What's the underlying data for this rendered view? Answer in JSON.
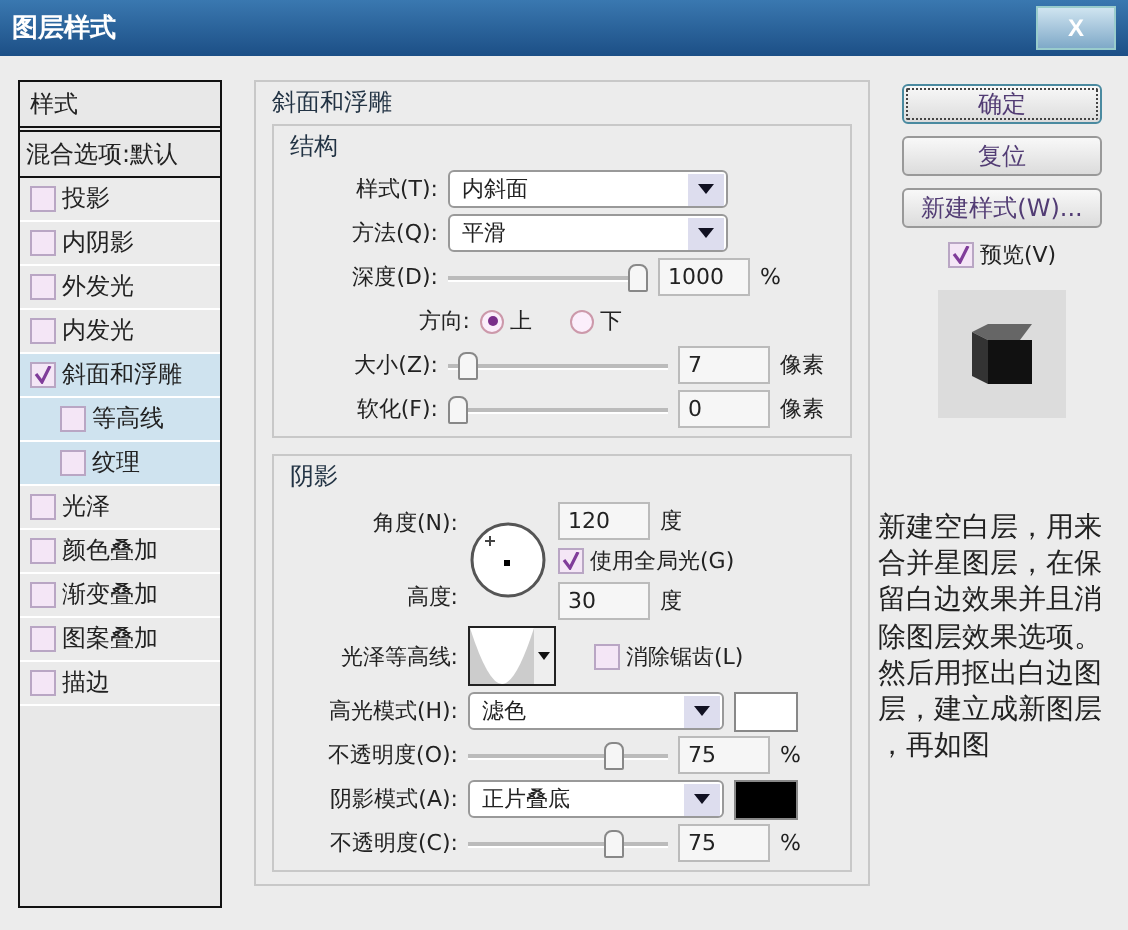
{
  "window": {
    "title": "图层样式",
    "close": "X"
  },
  "styles": {
    "header": "样式",
    "blend": "混合选项:默认",
    "items": [
      {
        "label": "投影",
        "checked": false,
        "selected": false
      },
      {
        "label": "内阴影",
        "checked": false,
        "selected": false
      },
      {
        "label": "外发光",
        "checked": false,
        "selected": false
      },
      {
        "label": "内发光",
        "checked": false,
        "selected": false
      },
      {
        "label": "斜面和浮雕",
        "checked": true,
        "selected": true,
        "children": [
          {
            "label": "等高线",
            "checked": false
          },
          {
            "label": "纹理",
            "checked": false
          }
        ]
      },
      {
        "label": "光泽",
        "checked": false,
        "selected": false
      },
      {
        "label": "颜色叠加",
        "checked": false,
        "selected": false
      },
      {
        "label": "渐变叠加",
        "checked": false,
        "selected": false
      },
      {
        "label": "图案叠加",
        "checked": false,
        "selected": false
      },
      {
        "label": "描边",
        "checked": false,
        "selected": false
      }
    ]
  },
  "bevel": {
    "title": "斜面和浮雕",
    "structure": {
      "title": "结构",
      "style": {
        "label": "样式(T):",
        "value": "内斜面"
      },
      "technique": {
        "label": "方法(Q):",
        "value": "平滑"
      },
      "depth": {
        "label": "深度(D):",
        "level": 1,
        "value": "1000",
        "unit": "%"
      },
      "direction": {
        "label": "方向:",
        "options": [
          {
            "label": "上",
            "selected": true
          },
          {
            "label": "下",
            "selected": false
          }
        ]
      },
      "size": {
        "label": "大小(Z):",
        "level": 0.05,
        "value": "7",
        "unit": "像素"
      },
      "soften": {
        "label": "软化(F):",
        "level": 0,
        "value": "0",
        "unit": "像素"
      }
    },
    "shading": {
      "title": "阴影",
      "angle": {
        "label": "角度(N):",
        "value": "120",
        "unit": "度"
      },
      "global_light": {
        "label": "使用全局光(G)",
        "checked": true
      },
      "altitude": {
        "label": "高度:",
        "value": "30",
        "unit": "度"
      },
      "gloss_contour": {
        "label": "光泽等高线:"
      },
      "anti_aliased": {
        "label": "消除锯齿(L)",
        "checked": false
      },
      "highlight_mode": {
        "label": "高光模式(H):",
        "value": "滤色",
        "color": "#ffffff"
      },
      "highlight_opacity": {
        "label": "不透明度(O):",
        "level": 0.75,
        "value": "75",
        "unit": "%"
      },
      "shadow_mode": {
        "label": "阴影模式(A):",
        "value": "正片叠底",
        "color": "#000000"
      },
      "shadow_opacity": {
        "label": "不透明度(C):",
        "level": 0.75,
        "value": "75",
        "unit": "%"
      }
    }
  },
  "buttons": [
    {
      "label": "确定",
      "default": true
    },
    {
      "label": "复位",
      "default": false
    },
    {
      "label": "新建样式(W)...",
      "default": false
    }
  ],
  "preview": {
    "label": "预览(V)",
    "checked": true
  },
  "note": "新建空白层，用来合并星图层，在保留白边效果并且消除图层效果选项。然后用抠出白边图层，建立成新图层，再如图"
}
